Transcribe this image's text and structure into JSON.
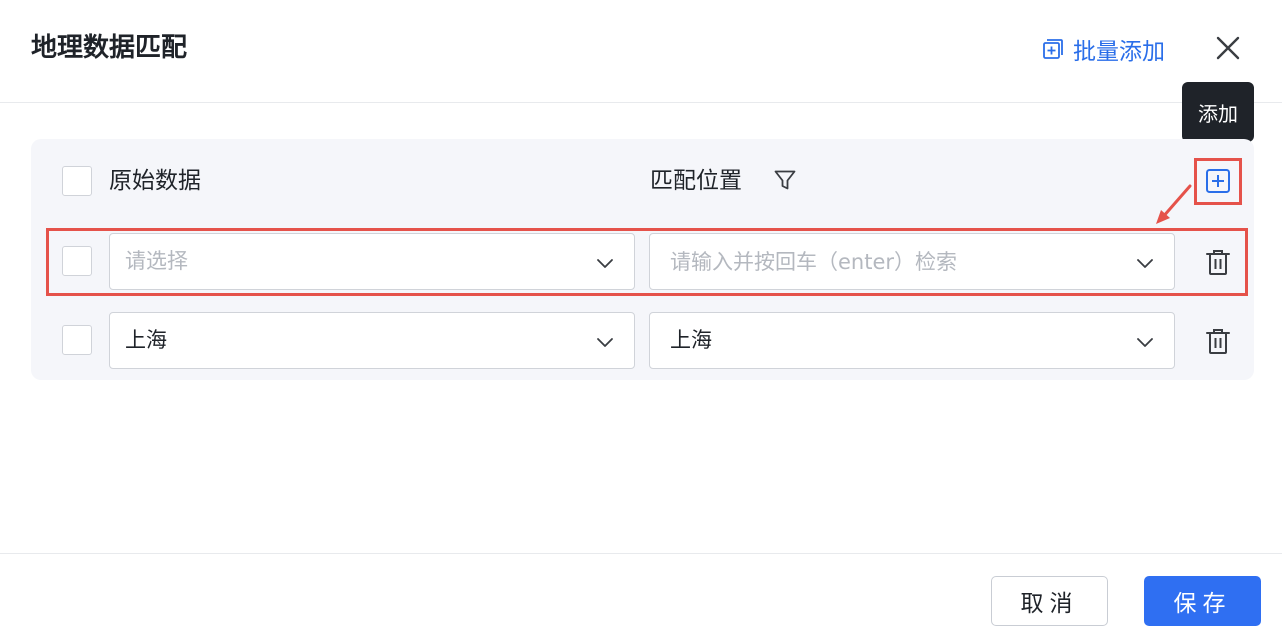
{
  "header": {
    "title": "地理数据匹配",
    "batch_add_label": "批量添加",
    "batch_add_icon": "copy-add-icon",
    "close_icon": "close-icon"
  },
  "tooltip": {
    "text": "添加"
  },
  "table": {
    "columns": {
      "original": "原始数据",
      "match": "匹配位置"
    },
    "header_icons": {
      "filter": "filter-icon",
      "add": "plus-square-icon"
    },
    "rows": [
      {
        "original_placeholder": "请选择",
        "original_value": "",
        "match_placeholder": "请输入并按回车（enter）检索",
        "match_value": ""
      },
      {
        "original_placeholder": "",
        "original_value": "上海",
        "match_placeholder": "",
        "match_value": "上海"
      }
    ]
  },
  "footer": {
    "cancel_label": "取消",
    "save_label": "保存"
  },
  "colors": {
    "accent": "#2f6ff2",
    "link": "#2a6ee9",
    "highlight": "#e5524a",
    "panel_bg": "#f5f6fa"
  }
}
